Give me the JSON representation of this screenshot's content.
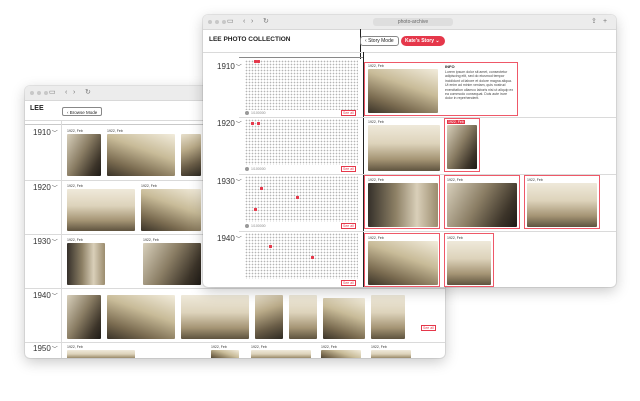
{
  "back_window": {
    "title": "LEE",
    "browse_button": "Browse Mode",
    "decades": [
      {
        "year": "1910"
      },
      {
        "year": "1920"
      },
      {
        "year": "1930"
      },
      {
        "year": "1940"
      },
      {
        "year": "1950"
      }
    ],
    "caption": "1922, Feb",
    "see_all": "See all"
  },
  "front_window": {
    "address": "photo-archive",
    "title": "LEE PHOTO COLLECTION",
    "story_mode_button": "Story Mode",
    "story_select": "Kate's Story",
    "decades": [
      {
        "year": "1910"
      },
      {
        "year": "1920"
      },
      {
        "year": "1930"
      },
      {
        "year": "1940"
      }
    ],
    "caption": "1922, Feb",
    "info_title": "INFO",
    "info_text": "Lorem ipsum dolor sit amet, consectetur adipiscing elit, sed do eiusmod tempor incididunt ut labore et dolore magna aliqua. Ut enim ad minim veniam, quis nostrud exercitation ullamco laboris nisi ut aliquip ex ea commodo consequat. Duis aute irure dolor in reprehenderit.",
    "see_all": "See all",
    "grid_count": "1/100000"
  },
  "colors": {
    "accent": "#e5374a"
  },
  "icons": {
    "back": "chevron-left-icon",
    "forward": "chevron-right-icon",
    "reload": "reload-icon",
    "share": "share-icon",
    "dropdown": "chevron-down-icon"
  }
}
